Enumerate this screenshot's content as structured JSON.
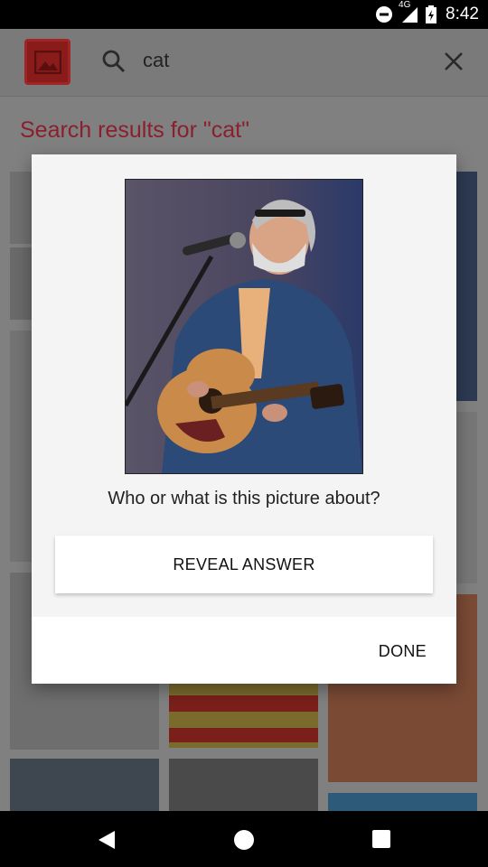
{
  "status_bar": {
    "network": "4G",
    "time": "8:42",
    "icons": [
      "do-not-disturb-icon",
      "signal-icon",
      "battery-icon"
    ]
  },
  "app_bar": {
    "logo_icon": "image-icon",
    "search_icon": "search-icon",
    "query": "cat",
    "clear_icon": "close-icon"
  },
  "results": {
    "title": "Search results for \"cat\""
  },
  "dialog": {
    "image_icon": "photo",
    "question": "Who or what is this picture about?",
    "reveal_label": "REVEAL ANSWER",
    "done_label": "DONE"
  },
  "nav_bar": {
    "back_icon": "back-icon",
    "home_icon": "home-icon",
    "recents_icon": "recents-icon"
  },
  "colors": {
    "accent": "#c2185b",
    "logo": "#d32f2f"
  }
}
